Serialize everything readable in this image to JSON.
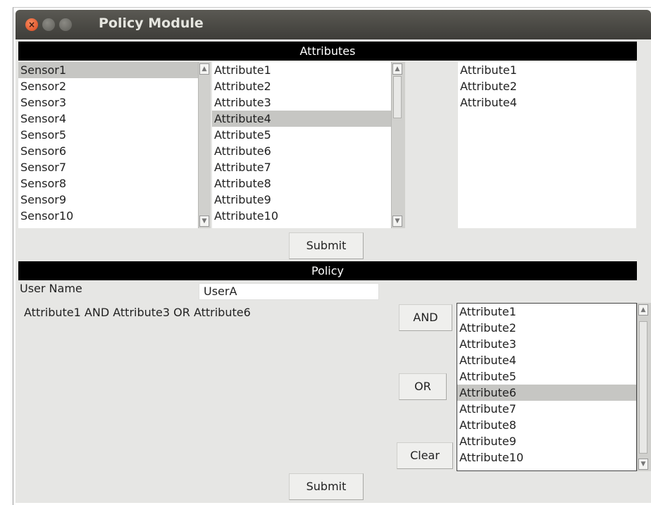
{
  "window": {
    "title": "Policy Module"
  },
  "attributes_section": {
    "header": "Attributes",
    "sensors": [
      "Sensor1",
      "Sensor2",
      "Sensor3",
      "Sensor4",
      "Sensor5",
      "Sensor6",
      "Sensor7",
      "Sensor8",
      "Sensor9",
      "Sensor10"
    ],
    "selected_sensor": "Sensor1",
    "attributes": [
      "Attribute1",
      "Attribute2",
      "Attribute3",
      "Attribute4",
      "Attribute5",
      "Attribute6",
      "Attribute7",
      "Attribute8",
      "Attribute9",
      "Attribute10"
    ],
    "selected_attribute": "Attribute4",
    "chosen_attributes": [
      "Attribute1",
      "Attribute2",
      "Attribute4"
    ],
    "submit_label": "Submit"
  },
  "policy_section": {
    "header": "Policy",
    "user_name_label": "User Name",
    "user_name_value": "UserA",
    "policy_expression": "Attribute1 AND Attribute3 OR Attribute6",
    "and_label": "AND",
    "or_label": "OR",
    "clear_label": "Clear",
    "attributes": [
      "Attribute1",
      "Attribute2",
      "Attribute3",
      "Attribute4",
      "Attribute5",
      "Attribute6",
      "Attribute7",
      "Attribute8",
      "Attribute9",
      "Attribute10"
    ],
    "selected_attribute": "Attribute6",
    "submit_label": "Submit"
  },
  "icons": {
    "close": "close-icon",
    "minimize": "minimize-icon",
    "maximize": "maximize-icon"
  }
}
